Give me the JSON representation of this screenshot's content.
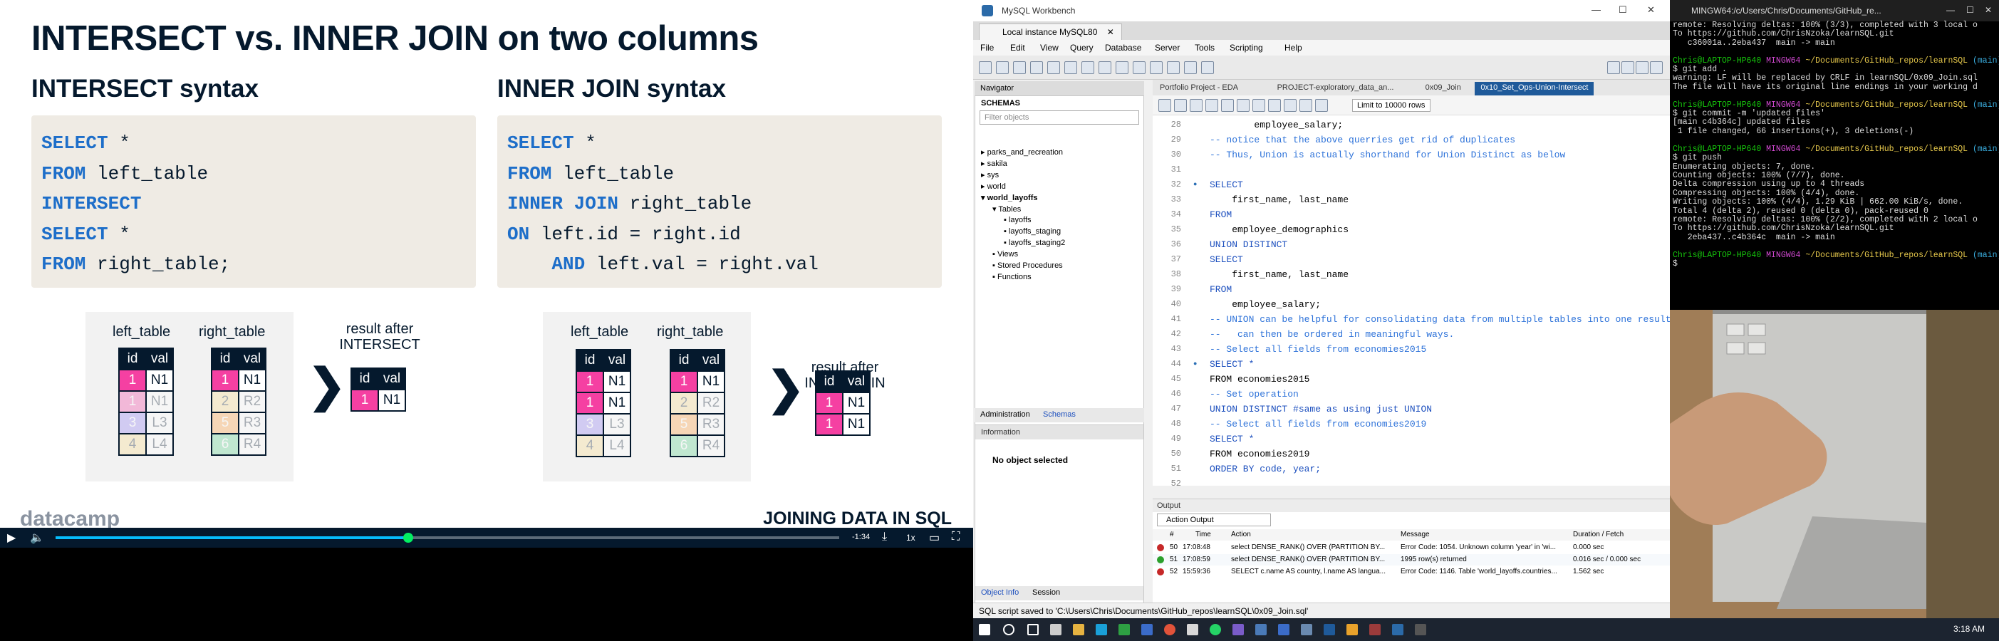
{
  "slide": {
    "title": "INTERSECT vs. INNER JOIN on two columns",
    "left_head": "INTERSECT syntax",
    "right_head": "INNER JOIN syntax",
    "code_left": [
      {
        "kw": "SELECT",
        "rest": " *"
      },
      {
        "kw": "FROM",
        "rest": " left_table"
      },
      {
        "kw": "INTERSECT",
        "rest": ""
      },
      {
        "kw": "SELECT",
        "rest": " *"
      },
      {
        "kw": "FROM",
        "rest": " right_table;"
      }
    ],
    "code_right": [
      {
        "kw": "SELECT",
        "rest": " *"
      },
      {
        "kw": "FROM",
        "rest": " left_table"
      },
      {
        "kw": "INNER JOIN",
        "rest": " right_table"
      },
      {
        "kw": "ON",
        "rest": " left.id = right.id"
      },
      {
        "kw": "AND",
        "rest": " left.val = right.val",
        "indent": "    "
      }
    ],
    "left_table_label": "left_table",
    "right_table_label": "right_table",
    "result_intersect": "result after INTERSECT",
    "result_join": "result after INNER JOIN",
    "col_id": "id",
    "col_val": "val",
    "chevron": "❯",
    "left_rows": [
      [
        "1",
        "N1"
      ],
      [
        "1",
        "N1"
      ],
      [
        "3",
        "L3"
      ],
      [
        "4",
        "L4"
      ]
    ],
    "right_rows": [
      [
        "1",
        "N1"
      ],
      [
        "2",
        "R2"
      ],
      [
        "5",
        "R3"
      ],
      [
        "6",
        "R4"
      ]
    ],
    "brand": "datacamp",
    "course": "JOINING DATA IN SQL"
  },
  "player": {
    "time_remaining": "-1:34",
    "speed": "1x",
    "progress": 0.45
  },
  "workbench": {
    "app_title": "MySQL Workbench",
    "connection_tab": "Local instance MySQL80",
    "menu": [
      "File",
      "Edit",
      "View",
      "Query",
      "Database",
      "Server",
      "Tools",
      "Scripting",
      "Help"
    ],
    "navigator": "Navigator",
    "schemas": "SCHEMAS",
    "filter_placeholder": "Filter objects",
    "tree": [
      "parks_and_recreation",
      "sakila",
      "sys",
      "world",
      "world_layoffs",
      "Tables",
      "layoffs",
      "layoffs_staging",
      "layoffs_staging2",
      "Views",
      "Stored Procedures",
      "Functions"
    ],
    "nav_tabs": [
      "Administration",
      "Schemas"
    ],
    "information": "Information",
    "no_object": "No object selected",
    "bottom_tabs": [
      "Object Info",
      "Session"
    ],
    "editor_tabs": [
      "Portfolio Project - EDA",
      "PROJECT-exploratory_data_an...",
      "0x09_Join",
      "0x10_Set_Ops-Union-Intersect"
    ],
    "limit": "Limit to 10000 rows",
    "code_lines": [
      {
        "n": "28",
        "t": "        employee_salary;",
        "c": ""
      },
      {
        "n": "29",
        "t": "-- notice that the above querries get rid of duplicates",
        "c": "comment"
      },
      {
        "n": "30",
        "t": "-- Thus, Union is actually shorthand for Union Distinct as below",
        "c": "comment"
      },
      {
        "n": "31",
        "t": "",
        "c": ""
      },
      {
        "n": "32",
        "t": "SELECT",
        "c": "skw",
        "bp": true
      },
      {
        "n": "33",
        "t": "    first_name, last_name",
        "c": ""
      },
      {
        "n": "34",
        "t": "FROM",
        "c": "skw"
      },
      {
        "n": "35",
        "t": "    employee_demographics",
        "c": ""
      },
      {
        "n": "36",
        "t": "UNION DISTINCT",
        "c": "skw"
      },
      {
        "n": "37",
        "t": "SELECT",
        "c": "skw"
      },
      {
        "n": "38",
        "t": "    first_name, last_name",
        "c": ""
      },
      {
        "n": "39",
        "t": "FROM",
        "c": "skw"
      },
      {
        "n": "40",
        "t": "    employee_salary;",
        "c": ""
      },
      {
        "n": "41",
        "t": "-- UNION can be helpful for consolidating data from multiple tables into one result that",
        "c": "comment"
      },
      {
        "n": "42",
        "t": "--   can then be ordered in meaningful ways.",
        "c": "comment"
      },
      {
        "n": "43",
        "t": "-- Select all fields from economies2015",
        "c": "comment"
      },
      {
        "n": "44",
        "t": "SELECT *",
        "c": "skw",
        "bp": true
      },
      {
        "n": "45",
        "t": "FROM economies2015",
        "c": ""
      },
      {
        "n": "46",
        "t": "-- Set operation",
        "c": "comment"
      },
      {
        "n": "47",
        "t": "UNION DISTINCT #same as using just UNION",
        "c": "skw"
      },
      {
        "n": "48",
        "t": "-- Select all fields from economies2019",
        "c": "comment"
      },
      {
        "n": "49",
        "t": "SELECT *",
        "c": "skw"
      },
      {
        "n": "50",
        "t": "FROM economies2019",
        "c": ""
      },
      {
        "n": "51",
        "t": "ORDER BY code, year;",
        "c": "skw"
      },
      {
        "n": "52",
        "t": "",
        "c": ""
      }
    ],
    "output_head": "Output",
    "action_output": "Action Output",
    "out_cols": [
      "#",
      "Time",
      "Action",
      "Message",
      "Duration / Fetch"
    ],
    "out_rows": [
      {
        "num": "50",
        "time": "17:08:48",
        "action": "select DENSE_RANK() OVER (PARTITION BY...",
        "msg": "Error Code: 1054. Unknown column 'year' in 'wi...",
        "dur": "0.000 sec",
        "ok": false
      },
      {
        "num": "51",
        "time": "17:08:59",
        "action": "select DENSE_RANK() OVER (PARTITION BY...",
        "msg": "1995 row(s) returned",
        "dur": "0.016 sec / 0.000 sec",
        "ok": true
      },
      {
        "num": "52",
        "time": "15:59:36",
        "action": "SELECT c.name AS country, l.name AS langua...",
        "msg": "Error Code: 1146. Table 'world_layoffs.countries...",
        "dur": "1.562 sec",
        "ok": false
      }
    ],
    "status": "SQL script saved to 'C:\\Users\\Chris\\Documents\\GitHub_repos\\learnSQL\\0x09_Join.sql'"
  },
  "terminal": {
    "title": "MINGW64:/c/Users/Chris/Documents/GitHub_re...",
    "lines": [
      {
        "t": "remote: Resolving deltas: 100% (3/3), completed with 3 local o",
        "c": ""
      },
      {
        "t": "To https://github.com/ChrisNzoka/learnSQL.git",
        "c": ""
      },
      {
        "t": "   c36001a..2eba437  main -> main",
        "c": ""
      },
      {
        "t": "",
        "c": ""
      },
      {
        "t": "Chris@LAPTOP-HP640 MINGW64 ~/Documents/GitHub_repos/learnSQL (main)",
        "c": "prompt"
      },
      {
        "t": "$ git add .",
        "c": ""
      },
      {
        "t": "warning: LF will be replaced by CRLF in learnSQL/0x09_Join.sql",
        "c": ""
      },
      {
        "t": "The file will have its original line endings in your working d",
        "c": ""
      },
      {
        "t": "",
        "c": ""
      },
      {
        "t": "Chris@LAPTOP-HP640 MINGW64 ~/Documents/GitHub_repos/learnSQL (main)",
        "c": "prompt"
      },
      {
        "t": "$ git commit -m 'updated files'",
        "c": ""
      },
      {
        "t": "[main c4b364c] updated files",
        "c": ""
      },
      {
        "t": " 1 file changed, 66 insertions(+), 3 deletions(-)",
        "c": ""
      },
      {
        "t": "",
        "c": ""
      },
      {
        "t": "Chris@LAPTOP-HP640 MINGW64 ~/Documents/GitHub_repos/learnSQL (main)",
        "c": "prompt"
      },
      {
        "t": "$ git push",
        "c": ""
      },
      {
        "t": "Enumerating objects: 7, done.",
        "c": ""
      },
      {
        "t": "Counting objects: 100% (7/7), done.",
        "c": ""
      },
      {
        "t": "Delta compression using up to 4 threads",
        "c": ""
      },
      {
        "t": "Compressing objects: 100% (4/4), done.",
        "c": ""
      },
      {
        "t": "Writing objects: 100% (4/4), 1.29 KiB | 662.00 KiB/s, done.",
        "c": ""
      },
      {
        "t": "Total 4 (delta 2), reused 0 (delta 0), pack-reused 0",
        "c": ""
      },
      {
        "t": "remote: Resolving deltas: 100% (2/2), completed with 2 local o",
        "c": ""
      },
      {
        "t": "To https://github.com/ChrisNzoka/learnSQL.git",
        "c": ""
      },
      {
        "t": "   2eba437..c4b364c  main -> main",
        "c": ""
      },
      {
        "t": "",
        "c": ""
      },
      {
        "t": "Chris@LAPTOP-HP640 MINGW64 ~/Documents/GitHub_repos/learnSQL (main)",
        "c": "prompt"
      },
      {
        "t": "$ ",
        "c": ""
      }
    ]
  },
  "taskbar": {
    "clock": "3:18 AM"
  }
}
